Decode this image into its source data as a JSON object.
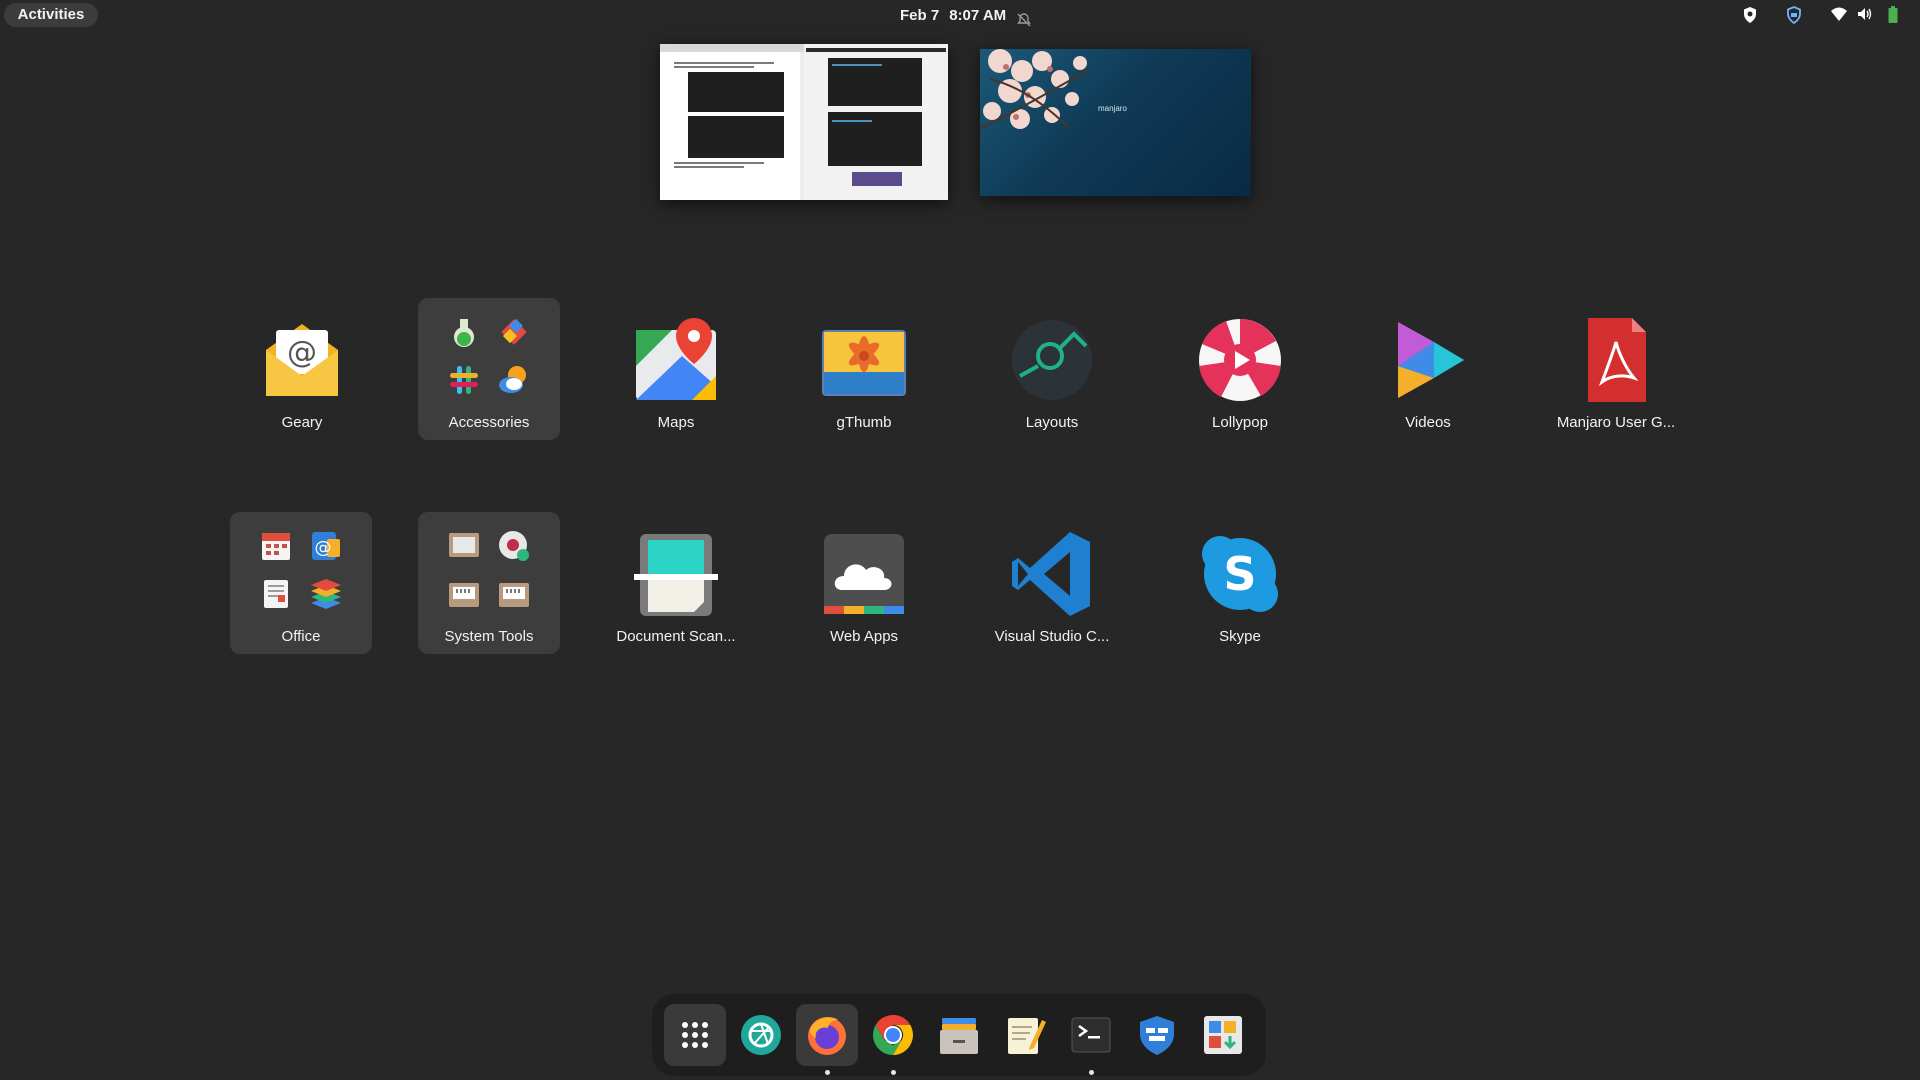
{
  "topbar": {
    "activities_label": "Activities",
    "date": "Feb 7",
    "time": "8:07 AM"
  },
  "workspace2": {
    "wallpaper_text": "manjaro"
  },
  "apps": [
    {
      "label": "Geary",
      "icon": "geary-icon"
    },
    {
      "label": "Accessories",
      "icon": "folder-icon"
    },
    {
      "label": "Maps",
      "icon": "maps-icon"
    },
    {
      "label": "gThumb",
      "icon": "gthumb-icon"
    },
    {
      "label": "Layouts",
      "icon": "layouts-icon"
    },
    {
      "label": "Lollypop",
      "icon": "lollypop-icon"
    },
    {
      "label": "Videos",
      "icon": "videos-icon"
    },
    {
      "label": "Manjaro User G...",
      "icon": "pdf-icon"
    },
    {
      "label": "Office",
      "icon": "folder-icon"
    },
    {
      "label": "System Tools",
      "icon": "folder-icon"
    },
    {
      "label": "Document Scan...",
      "icon": "scanner-icon"
    },
    {
      "label": "Web Apps",
      "icon": "webapps-icon"
    },
    {
      "label": "Visual Studio C...",
      "icon": "vscode-icon"
    },
    {
      "label": "Skype",
      "icon": "skype-icon"
    }
  ],
  "dock": [
    {
      "icon": "show-apps-icon"
    },
    {
      "icon": "aperture-icon"
    },
    {
      "icon": "firefox-icon",
      "running": true
    },
    {
      "icon": "chrome-icon",
      "running": true
    },
    {
      "icon": "files-icon"
    },
    {
      "icon": "text-editor-icon"
    },
    {
      "icon": "terminal-icon",
      "running": true
    },
    {
      "icon": "firewall-icon"
    },
    {
      "icon": "software-icon"
    }
  ],
  "colors": {
    "background": "#272727",
    "folder_bg": "#3d3d3d",
    "dock_bg": "#1e1e1e"
  }
}
